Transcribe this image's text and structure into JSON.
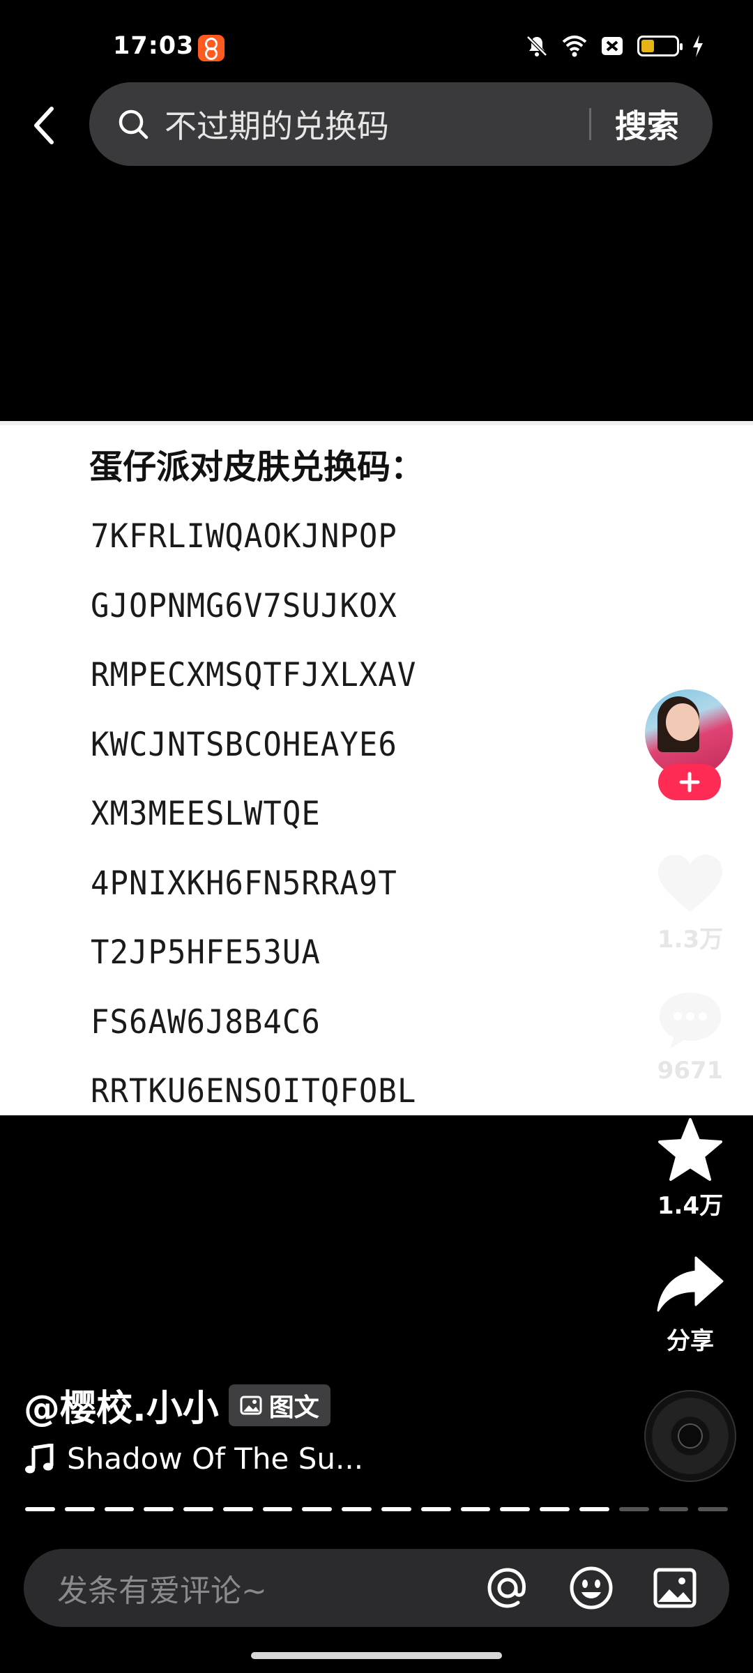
{
  "status_bar": {
    "time": "17:03"
  },
  "search": {
    "query": "不过期的兑换码",
    "button_label": "搜索"
  },
  "content_image": {
    "title": "蛋仔派对皮肤兑换码：",
    "codes": [
      "7KFRLIWQAOKJNPOP",
      "GJOPNMG6V7SUJKOX",
      "RMPECXMSQTFJXLXAV",
      "KWCJNTSBCOHEAYE6",
      "XM3MEESLWTQE",
      "4PNIXKH6FN5RRA9T",
      "T2JP5HFE53UA",
      "FS6AW6J8B4C6",
      "RRTKU6ENSOITQFOBL"
    ]
  },
  "actions": {
    "like_count": "1.3万",
    "comment_count": "9671",
    "favorite_count": "1.4万",
    "share_label": "分享"
  },
  "post": {
    "author": "@樱校.小小",
    "type_tag": "图文",
    "music_title": "Shadow Of The Su..."
  },
  "progress": {
    "total_pages": 18,
    "current_page": 15
  },
  "comment": {
    "placeholder": "发条有爱评论~"
  },
  "colors": {
    "follow_accent": "#fe2c55",
    "battery": "#e7b416"
  }
}
